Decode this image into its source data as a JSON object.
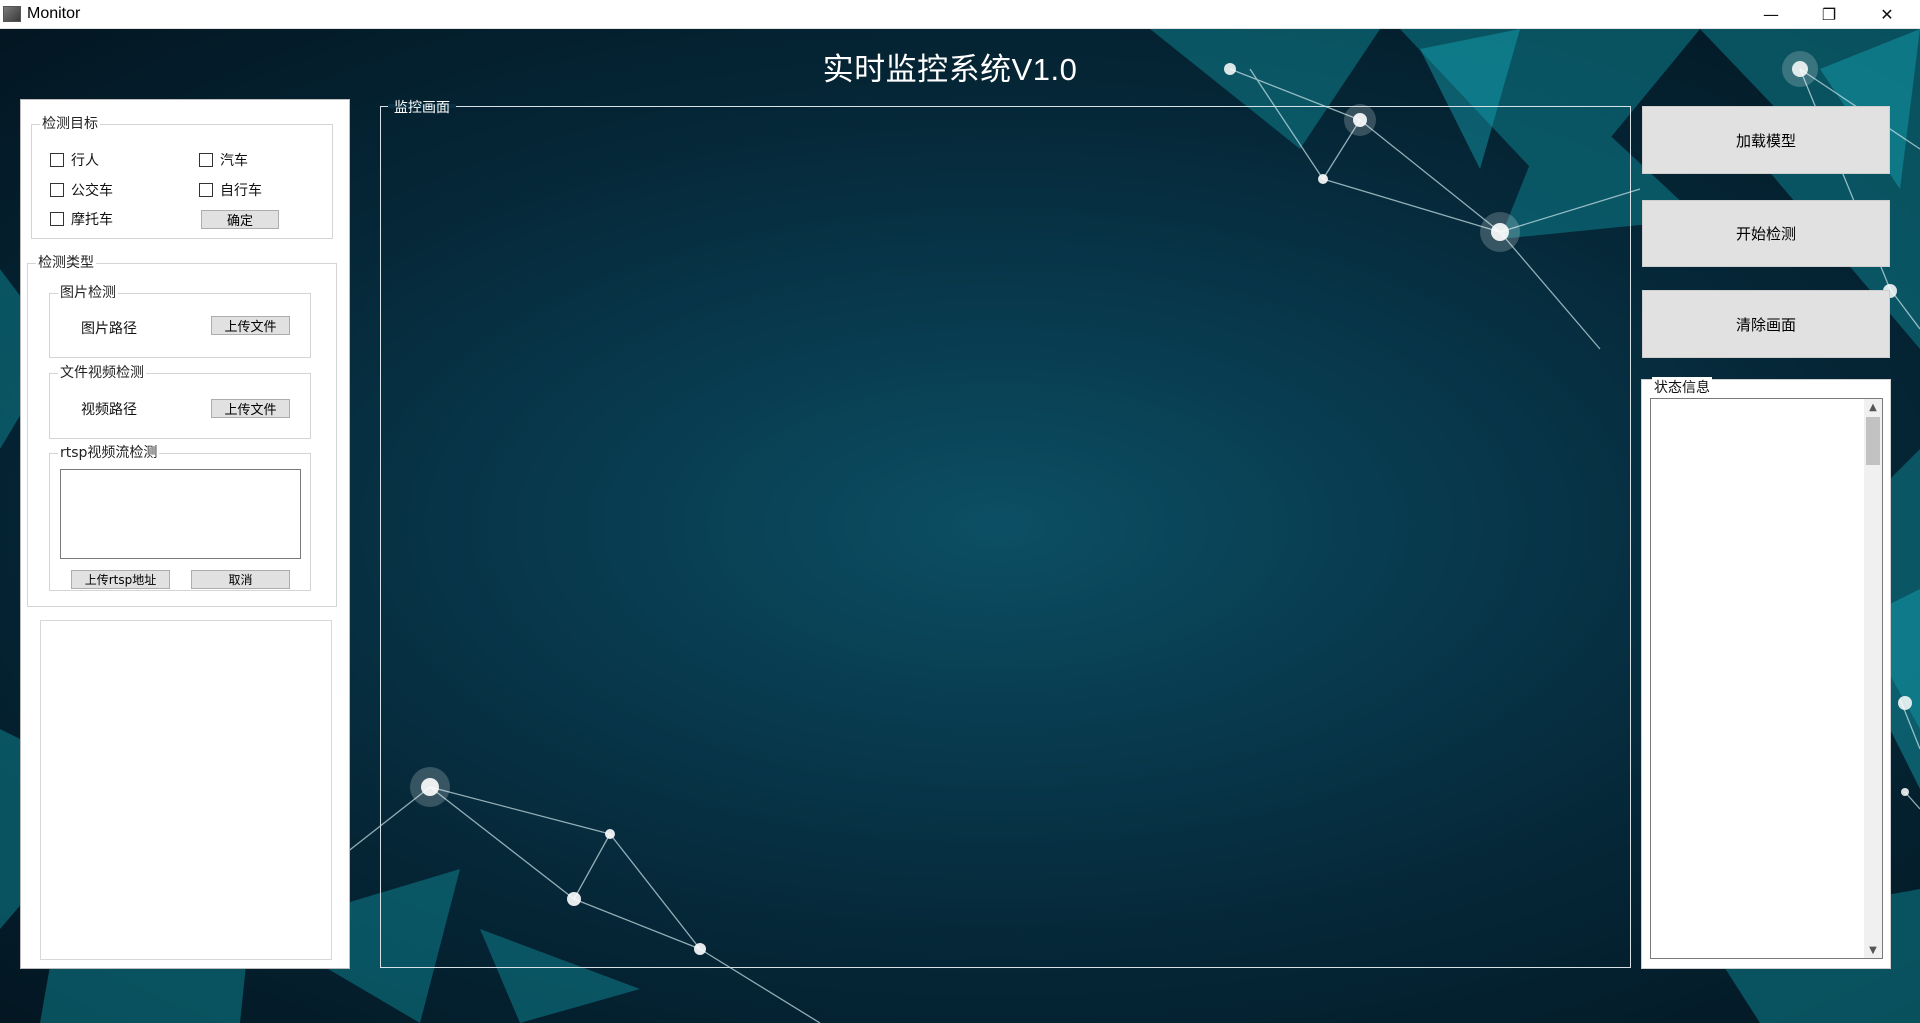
{
  "window": {
    "title": "Monitor",
    "controls": {
      "minimize": "—",
      "maximize": "❐",
      "close": "✕"
    }
  },
  "main_title": "实时监控系统V1.0",
  "left_panel": {
    "targets": {
      "legend": "检测目标",
      "options": [
        {
          "label": "行人",
          "checked": false
        },
        {
          "label": "汽车",
          "checked": false
        },
        {
          "label": "公交车",
          "checked": false
        },
        {
          "label": "自行车",
          "checked": false
        },
        {
          "label": "摩托车",
          "checked": false
        }
      ],
      "confirm_label": "确定"
    },
    "detection_type": {
      "legend": "检测类型",
      "image": {
        "legend": "图片检测",
        "path_label": "图片路径",
        "upload_label": "上传文件"
      },
      "video": {
        "legend": "文件视频检测",
        "path_label": "视频路径",
        "upload_label": "上传文件"
      },
      "rtsp": {
        "legend": "rtsp视频流检测",
        "input_value": "",
        "upload_label": "上传rtsp地址",
        "cancel_label": "取消"
      }
    }
  },
  "monitor": {
    "legend": "监控画面"
  },
  "right_panel": {
    "buttons": {
      "load_model": "加载模型",
      "start_detect": "开始检测",
      "clear_screen": "清除画面"
    },
    "status": {
      "legend": "状态信息",
      "text": ""
    }
  },
  "colors": {
    "bg_center": "#0c4f64",
    "bg_edge": "#031622",
    "accent_cyan": "#1fb5c7",
    "button_gray": "#e1e1e1"
  },
  "icons": {
    "scroll_up": "▲",
    "scroll_down": "▼"
  }
}
